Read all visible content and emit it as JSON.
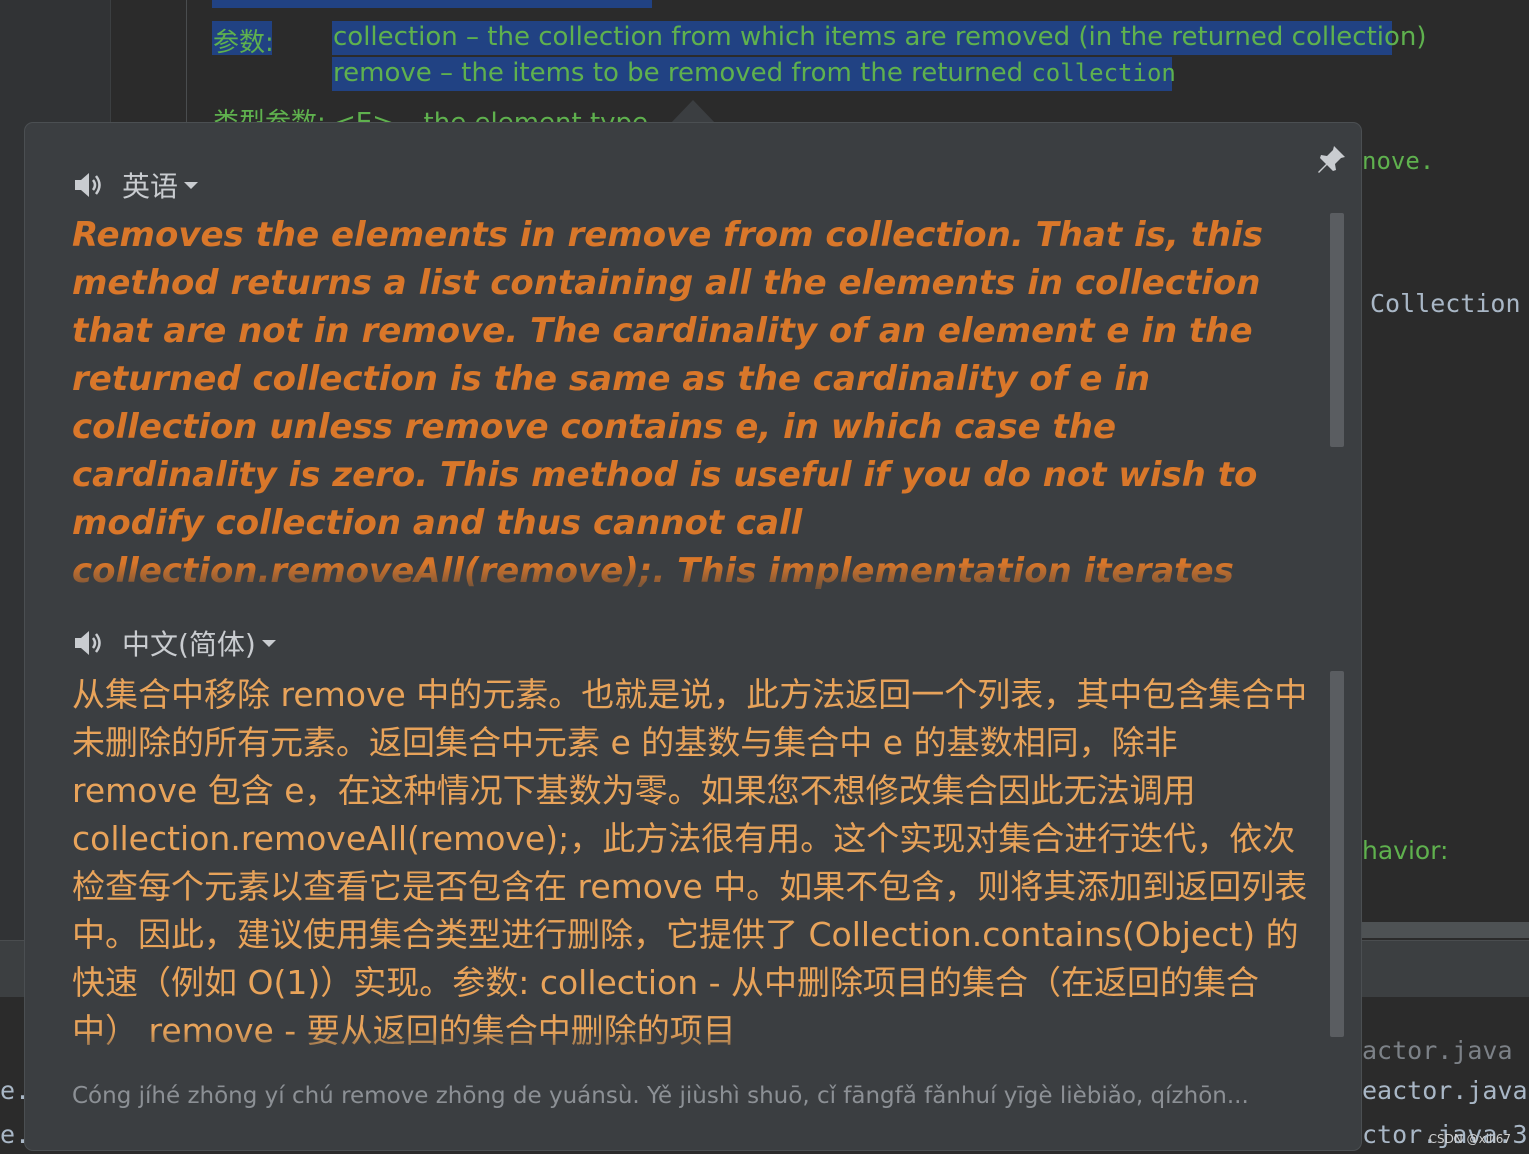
{
  "ide": {
    "doc_param_label": "参数:",
    "doc_param_line1": "collection – the collection from which items are removed (in the returned collection)",
    "doc_param_line2": "remove – the items to be removed from the returned ",
    "doc_param_line2_code": "collection",
    "doc_type_param": "类型参数: <E> – the element type",
    "right_texts": [
      "nove.",
      "Collection",
      "havior:",
      "actor.java",
      "eactor.java",
      "ctor.java:3"
    ],
    "left_texts": [
      "e.",
      "e."
    ]
  },
  "popup": {
    "source": {
      "language": "英语",
      "text": "Removes the elements in remove from collection. That is, this method returns a list containing all the elements in collection that are not in remove. The cardinality of an element e in the returned collection is the same as the cardinality of e in collection unless remove contains e, in which case the cardinality is zero. This method is useful if you do not wish to modify collection and thus cannot call collection.removeAll(remove);. This implementation iterates over collection, checking each element in turn to see if it's contained in remove. If it's not contained, it's added to the returned list."
    },
    "target": {
      "language": "中文(简体)",
      "text": "从集合中移除 remove 中的元素。也就是说，此方法返回一个列表，其中包含集合中未删除的所有元素。返回集合中元素 e 的基数与集合中 e 的基数相同，除非 remove 包含 e，在这种情况下基数为零。如果您不想修改集合因此无法调用 collection.removeAll(remove);，此方法很有用。这个实现对集合进行迭代，依次检查每个元素以查看它是否包含在 remove 中。如果不包含，则将其添加到返回列表中。因此，建议使用集合类型进行删除，它提供了 Collection.contains(Object) 的快速（例如 O(1)）实现。参数: collection - 从中删除项目的集合（在返回的集合中） remove - 要从返回的集合中删除的项目"
    },
    "pinyin": "Cóng jíhé zhōng yí chú remove zhōng de yuánsù. Yě jiùshì shuō, cǐ fāngfǎ fǎnhuí yīgè lièbiǎo, qízhōn..."
  },
  "watermark": "CSDN @xiii67",
  "colors": {
    "source_text": "#d9772a",
    "target_text": "#e8a35a",
    "popup_bg": "#3b3e41",
    "selection": "#214283",
    "doc_green": "#5fb14e"
  },
  "icons": [
    "speaker-icon",
    "caret-down-icon",
    "pin-icon"
  ]
}
